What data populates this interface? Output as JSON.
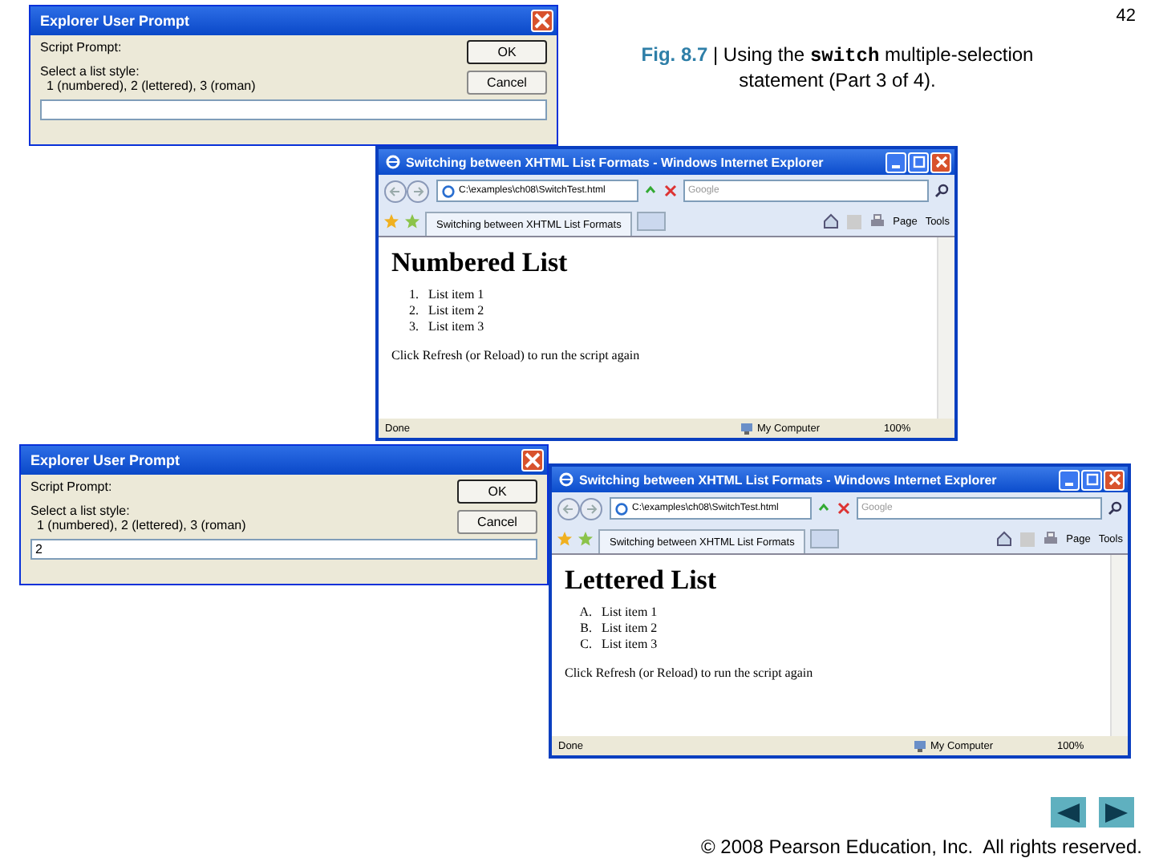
{
  "page_number": "42",
  "figure": {
    "label": "Fig. 8.7",
    "caption": "| Using the **switch** multiple-selection statement (Part 3 of 4)."
  },
  "dialogs": [
    {
      "title": "Explorer User Prompt",
      "prompt_label": "Script Prompt:",
      "message_lines": [
        "Select a list style:",
        "1 (numbered), 2 (lettered), 3 (roman)"
      ],
      "buttons": [
        "OK",
        "Cancel"
      ]
    },
    {
      "title": "Explorer User Prompt",
      "prompt_label": "Script Prompt:",
      "message_lines": [
        "Select a list style:",
        "1 (numbered), 2 (lettered), 3 (roman)"
      ],
      "buttons": [
        "OK",
        "Cancel"
      ],
      "value": "2"
    }
  ],
  "browsers": [
    {
      "title": "Switching between XHTML List Formats - Windows Internet Explorer",
      "address": "C:\\examples\\ch08\\SwitchTest.html",
      "search_placeholder": "Google",
      "tab": "Switching between XHTML List Formats",
      "toolbar": [
        "Page",
        "Tools"
      ],
      "heading": "Numbered List",
      "items": [
        {
          "marker": "1.",
          "text": "List item 1"
        },
        {
          "marker": "2.",
          "text": "List item 2"
        },
        {
          "marker": "3.",
          "text": "List item 3"
        }
      ],
      "paragraph": "Click Refresh (or Reload) to run the script again",
      "status": "Done",
      "zone": "My Computer",
      "zoom": "100%"
    },
    {
      "title": "Switching between XHTML List Formats - Windows Internet Explorer",
      "address": "C:\\examples\\ch08\\SwitchTest.html",
      "search_placeholder": "Google",
      "tab": "Switching between XHTML List Formats",
      "toolbar": [
        "Page",
        "Tools"
      ],
      "heading": "Lettered List",
      "items": [
        {
          "marker": "A.",
          "text": "List item 1"
        },
        {
          "marker": "B.",
          "text": "List item 2"
        },
        {
          "marker": "C.",
          "text": "List item 3"
        }
      ],
      "paragraph": "Click Refresh (or Reload) to run the script again",
      "status": "Done",
      "zone": "My Computer",
      "zoom": "100%"
    }
  ],
  "copyright": "© 2008 Pearson Education, Inc.  All rights reserved."
}
